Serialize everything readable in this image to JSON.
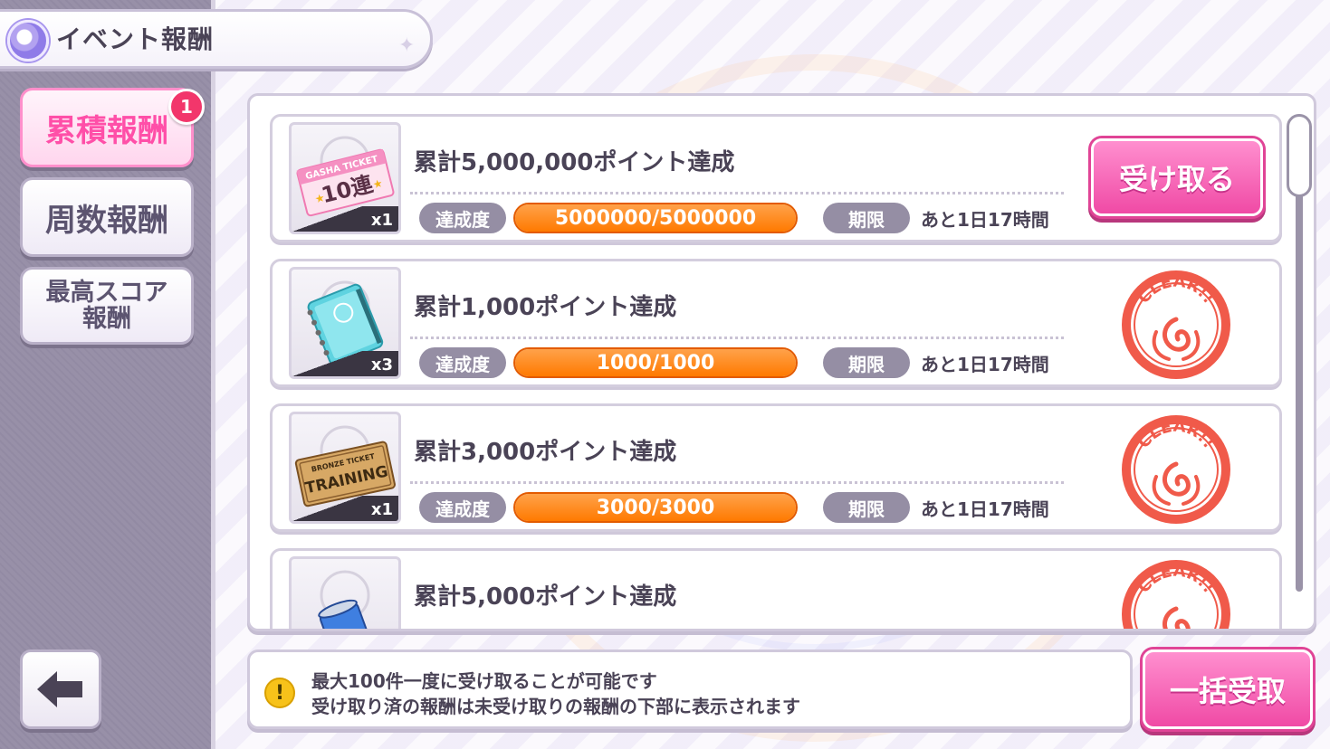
{
  "header": {
    "title": "イベント報酬"
  },
  "tabs": [
    {
      "label": "累積報酬",
      "active": true,
      "badge": "1"
    },
    {
      "label": "周数報酬",
      "active": false
    },
    {
      "label_line1": "最高スコア",
      "label_line2": "報酬",
      "active": false
    }
  ],
  "rewards": [
    {
      "title": "累計5,000,000ポイント達成",
      "item_count": "x1",
      "item_icon": "gacha-ticket-10-icon",
      "item_text_top": "GASHA TICKET",
      "item_text_main": "10連",
      "progress_label": "達成度",
      "progress_text": "5000000/5000000",
      "progress_fraction": 1.0,
      "limit_label": "期限",
      "limit_text": "あと1日17時間",
      "action": "受け取る",
      "status": "claimable"
    },
    {
      "title": "累計1,000ポイント達成",
      "item_count": "x3",
      "item_icon": "notebook-icon",
      "progress_label": "達成度",
      "progress_text": "1000/1000",
      "progress_fraction": 1.0,
      "limit_label": "期限",
      "limit_text": "あと1日17時間",
      "stamp_text": "CLEAR!!",
      "status": "cleared"
    },
    {
      "title": "累計3,000ポイント達成",
      "item_count": "x1",
      "item_icon": "bronze-training-ticket-icon",
      "item_text_top": "BRONZE TICKET",
      "item_text_main": "TRAINING",
      "progress_label": "達成度",
      "progress_text": "3000/3000",
      "progress_fraction": 1.0,
      "limit_label": "期限",
      "limit_text": "あと1日17時間",
      "stamp_text": "CLEAR!!",
      "status": "cleared"
    },
    {
      "title": "累計5,000ポイント達成",
      "item_icon": "drink-can-icon",
      "stamp_text": "CLEAR!!",
      "status": "cleared"
    }
  ],
  "info": {
    "line1": "最大100件一度に受け取ることが可能です",
    "line2": "受け取り済の報酬は未受け取りの報酬の下部に表示されます"
  },
  "bulk_button": "一括受取",
  "colors": {
    "accent_pink": "#f04aa5",
    "progress_orange": "#ff7a00",
    "stamp_red": "#f05a4a"
  }
}
